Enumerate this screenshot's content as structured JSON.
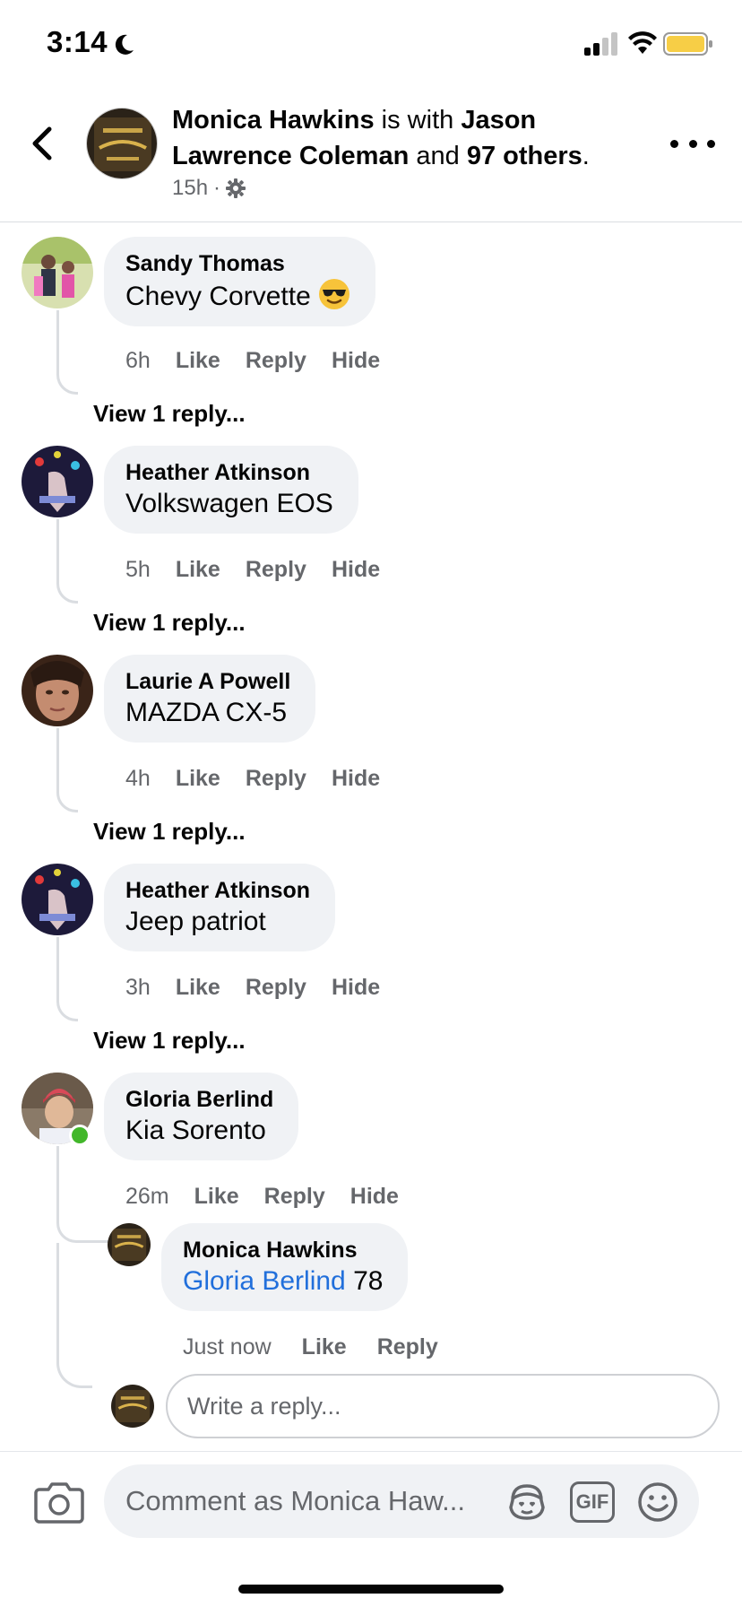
{
  "status_bar": {
    "time": "3:14"
  },
  "header": {
    "author": "Monica Hawkins",
    "with_text": " is with ",
    "tagged": "Jason Lawrence Coleman",
    "and_text": " and ",
    "others": "97 others",
    "period": ".",
    "time": "15h",
    "separator": "·"
  },
  "comments": [
    {
      "name": "Sandy Thomas",
      "text": "Chevy Corvette",
      "time": "6h",
      "like": "Like",
      "reply": "Reply",
      "hide": "Hide",
      "view_reply": "View 1 reply..."
    },
    {
      "name": "Heather Atkinson",
      "text": "Volkswagen EOS",
      "time": "5h",
      "like": "Like",
      "reply": "Reply",
      "hide": "Hide",
      "view_reply": "View 1 reply..."
    },
    {
      "name": "Laurie A Powell",
      "text": "MAZDA CX-5",
      "time": "4h",
      "like": "Like",
      "reply": "Reply",
      "hide": "Hide",
      "view_reply": "View 1 reply..."
    },
    {
      "name": "Heather Atkinson",
      "text": "Jeep patriot",
      "time": "3h",
      "like": "Like",
      "reply": "Reply",
      "hide": "Hide",
      "view_reply": "View 1 reply..."
    },
    {
      "name": "Gloria Berlind",
      "text": "Kia Sorento",
      "time": "26m",
      "like": "Like",
      "reply": "Reply",
      "hide": "Hide"
    }
  ],
  "reply": {
    "name": "Monica Hawkins",
    "mention": "Gloria Berlind",
    "text": " 78",
    "time": "Just now",
    "like": "Like",
    "reply": "Reply"
  },
  "reply_input": {
    "placeholder": "Write a reply..."
  },
  "composer": {
    "placeholder": "Comment as Monica Haw...",
    "gif_label": "GIF"
  },
  "colors": {
    "accent": "#216fdb",
    "bubble": "#f0f2f5",
    "secondary_text": "#65676b",
    "online": "#42b72a",
    "battery": "#f7ce46"
  }
}
